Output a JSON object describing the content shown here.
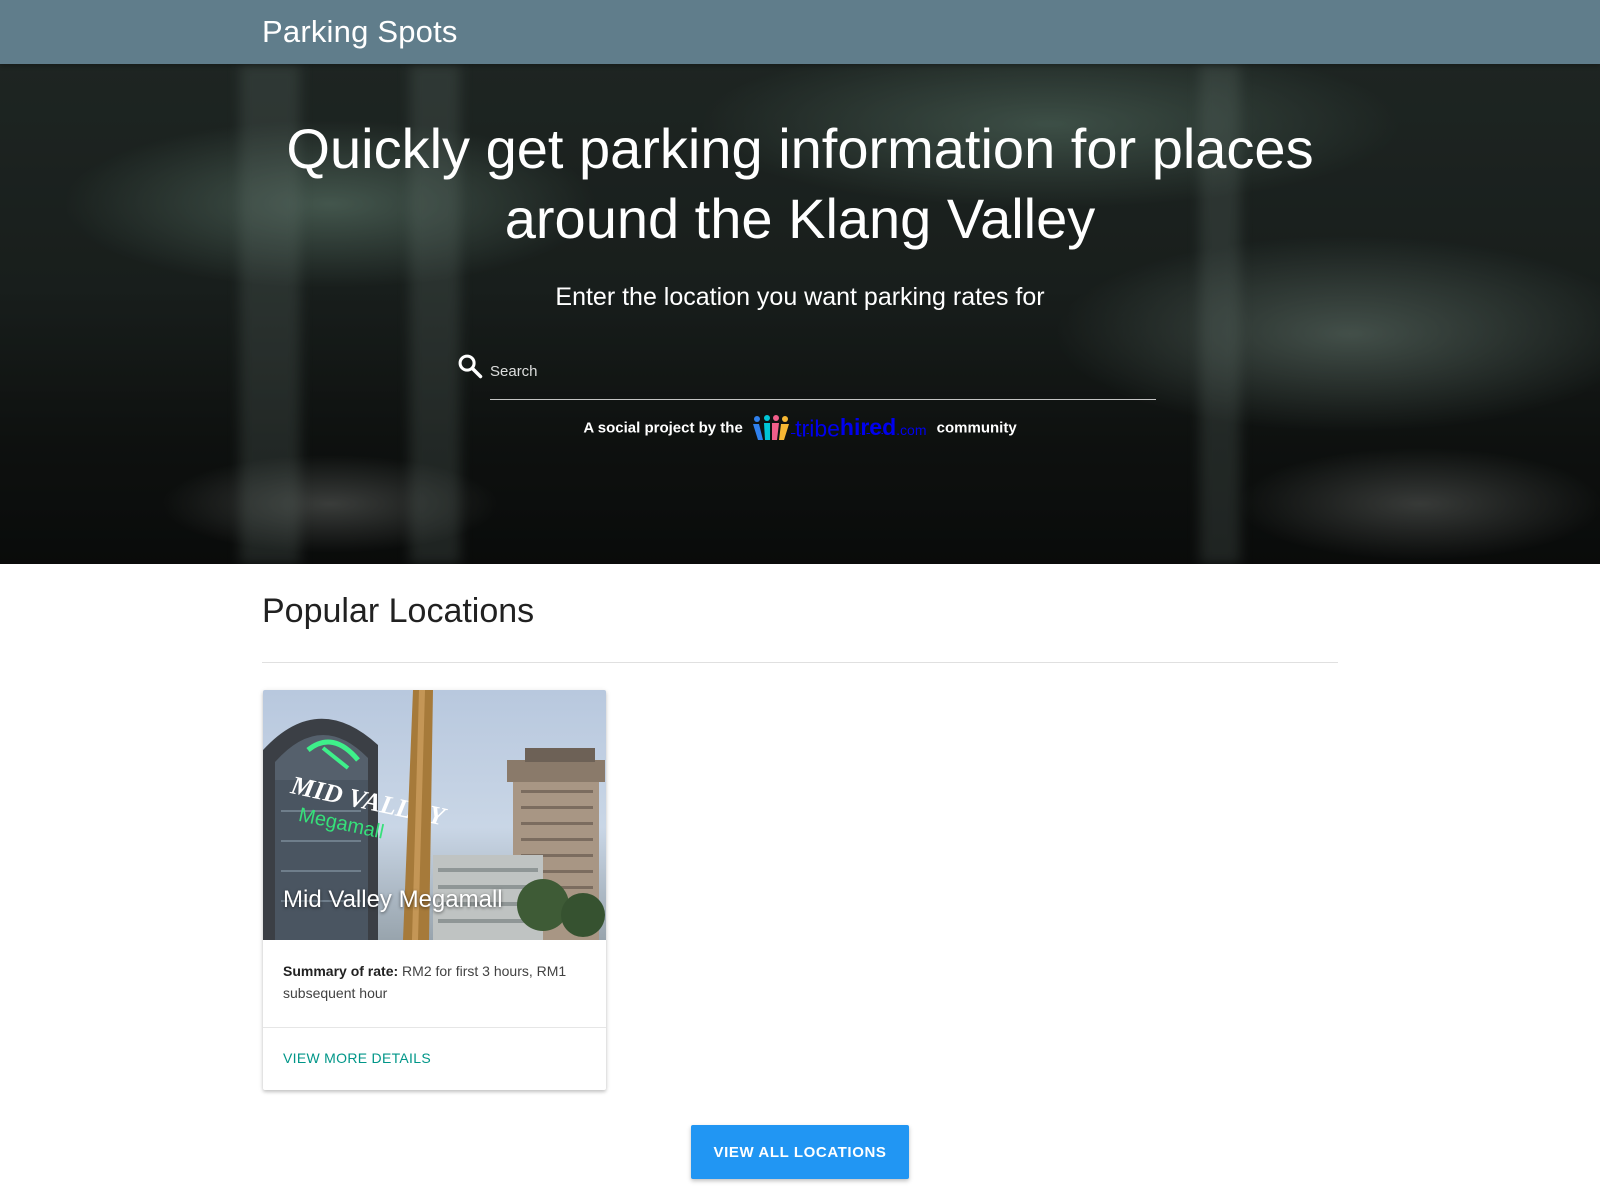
{
  "navbar": {
    "brand": "Parking Spots"
  },
  "hero": {
    "title_line1": "Quickly get parking information for places",
    "title_line2": "around the Klang Valley",
    "subtitle": "Enter the location you want parking rates for",
    "search": {
      "placeholder": "Search",
      "icon": "search-icon"
    },
    "credit": {
      "prefix": "A social project by the",
      "logo_text_light": "tribe",
      "logo_text_bold": "hired",
      "logo_text_suffix": ".com",
      "suffix": "community"
    }
  },
  "popular": {
    "title": "Popular Locations",
    "cards": [
      {
        "name": "Mid Valley Megamall",
        "summary_label": "Summary of rate:",
        "summary_text": " RM2 for first 3 hours, RM1 subsequent hour",
        "link_label": "VIEW MORE DETAILS"
      }
    ],
    "view_all_label": "VIEW ALL LOCATIONS"
  },
  "colors": {
    "navbar": "#607d8b",
    "link": "#009688",
    "button": "#2196f3"
  }
}
